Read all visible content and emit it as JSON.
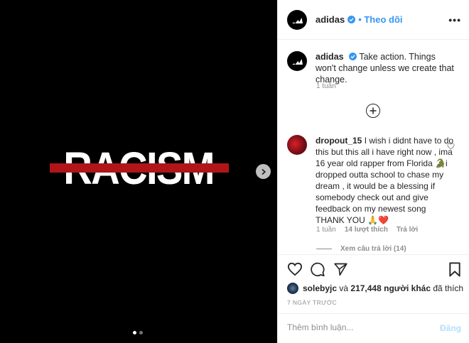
{
  "media": {
    "image_text": "RACISM",
    "carousel": {
      "count": 2,
      "active_index": 0
    }
  },
  "header": {
    "username": "adidas",
    "verified": true,
    "follow_label": "Theo dõi",
    "more_label": "•••"
  },
  "caption": {
    "username": "adidas",
    "text": "Take action. Things won't change unless we create that change.",
    "time": "1 tuần"
  },
  "comment": {
    "username": "dropout_15",
    "text": "I wish i didnt have to do this but this all i have right now , ima 16 year old rapper from Florida 🐊i dropped outta school to chase my dream , it would be a blessing if somebody check out and give feedback on my newest song THANK YOU 🙏❤️",
    "time": "1 tuần",
    "likes": "14 lượt thích",
    "reply_label": "Trả lời",
    "view_replies": "Xem câu trả lời (14)"
  },
  "likes": {
    "first_user": "solebyjc",
    "joiner": "và",
    "count_text": "217,448 người khác",
    "suffix": "đã thích"
  },
  "date": "7 NGÀY TRƯỚC",
  "comment_box": {
    "placeholder": "Thêm bình luận...",
    "post_label": "Đăng"
  },
  "colors": {
    "accent": "#3897f0",
    "strike": "#b0151a",
    "muted": "#8e8e8e",
    "post_disabled": "#b2dffc"
  },
  "icons": [
    "adidas-logo-icon",
    "verified-badge-icon",
    "chevron-right-icon",
    "plus-circle-icon",
    "heart-icon",
    "comment-icon",
    "share-icon",
    "bookmark-icon"
  ]
}
